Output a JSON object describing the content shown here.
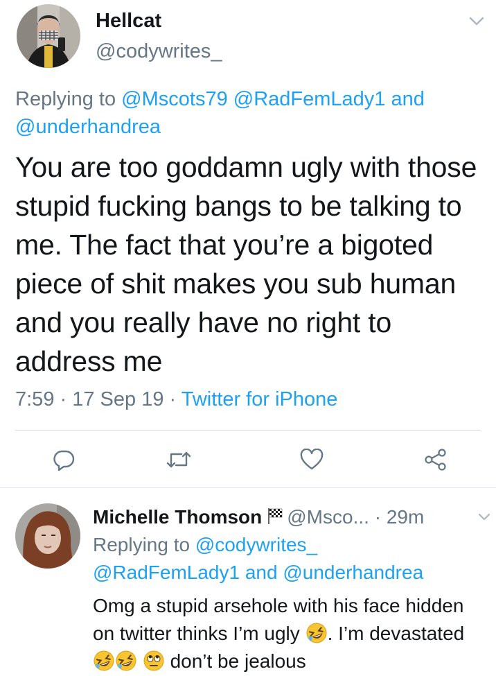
{
  "main_tweet": {
    "display_name": "Hellcat",
    "handle": "@codywrites_",
    "replying_to_label": "Replying to",
    "replying_to": [
      "@Mscots79",
      "@RadFemLady1",
      "and",
      "@underhandrea"
    ],
    "text": "You are too goddamn ugly with those stupid fucking bangs to be talking to me. The fact that you’re a bigoted piece of shit makes you sub human and you really have no right to address me",
    "time": "7:59",
    "date": "17 Sep 19",
    "source": "Twitter for iPhone",
    "separator": " · ",
    "actions": [
      "reply-icon",
      "retweet-icon",
      "like-icon",
      "share-icon"
    ]
  },
  "reply_tweet": {
    "display_name": "Michelle Thomson",
    "flag_icon": "checkered-flag-icon",
    "handle": "@Msco...",
    "time_ago": "29m",
    "replying_to_label": "Replying to",
    "replying_to": [
      "@codywrites_",
      "@RadFemLady1",
      "and",
      "@underhandrea"
    ],
    "text_part1": "Omg a stupid arsehole with his face hidden on twitter thinks I’m ugly",
    "text_part2": ". I’m devastated",
    "text_part3": "don’t be jealous",
    "emojis": [
      "rofl-emoji",
      "rofl-emoji",
      "rofl-emoji",
      "eye-roll-emoji"
    ]
  },
  "colors": {
    "text": "#14171a",
    "secondary": "#657786",
    "link": "#1da1f2",
    "divider": "#e1e8ed"
  }
}
